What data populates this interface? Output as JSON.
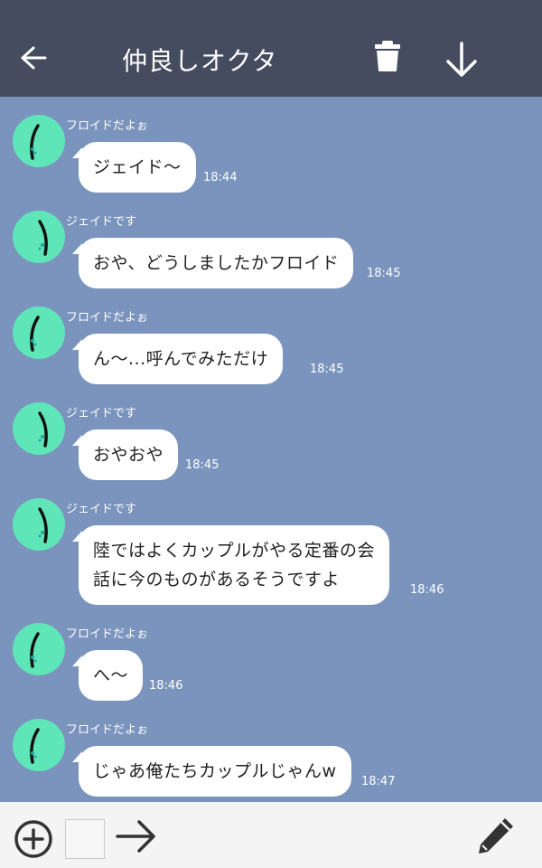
{
  "header": {
    "title": "仲良しオクタ",
    "back_icon": "arrow-left-icon",
    "trash_icon": "trash-icon",
    "download_icon": "arrow-down-icon"
  },
  "colors": {
    "header_bg": "#464c5f",
    "chat_bg": "#7b94bd",
    "avatar_bg": "#5fe6b8",
    "bubble_bg": "#ffffff",
    "footer_bg": "#f4f4f4"
  },
  "messages": [
    {
      "sender": "フロイドだよぉ",
      "text": "ジェイド〜",
      "time": "18:44"
    },
    {
      "sender": "ジェイドです",
      "text": "おや、どうしましたかフロイド",
      "time": "18:45"
    },
    {
      "sender": "フロイドだよぉ",
      "text": "ん〜...呼んでみただけ",
      "time": "18:45"
    },
    {
      "sender": "ジェイドです",
      "text": "おやおや",
      "time": "18:45"
    },
    {
      "sender": "ジェイドです",
      "text": "陸ではよくカップルがやる定番の会\n話に今のものがあるそうですよ",
      "time": "18:46"
    },
    {
      "sender": "フロイドだよぉ",
      "text": "へ〜",
      "time": "18:46"
    },
    {
      "sender": "フロイドだよぉ",
      "text": "じゃあ俺たちカップルじゃんw",
      "time": "18:47"
    }
  ],
  "footer": {
    "add_icon": "plus-circle-icon",
    "send_icon": "arrow-right-icon",
    "edit_icon": "pencil-icon"
  }
}
